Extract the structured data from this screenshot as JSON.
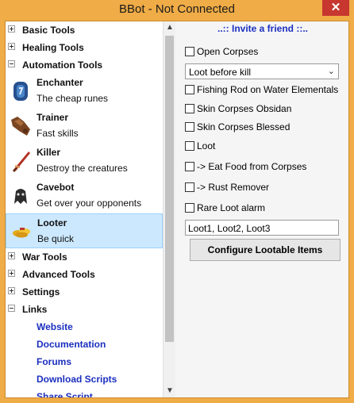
{
  "window": {
    "title": "BBot - Not Connected",
    "close_glyph": "✕"
  },
  "sidebar": {
    "categories": [
      {
        "label": "Basic Tools",
        "expanded": false
      },
      {
        "label": "Healing Tools",
        "expanded": false
      },
      {
        "label": "Automation Tools",
        "expanded": true
      },
      {
        "label": "War Tools",
        "expanded": false
      },
      {
        "label": "Advanced Tools",
        "expanded": false
      },
      {
        "label": "Settings",
        "expanded": false
      },
      {
        "label": "Links",
        "expanded": true
      }
    ],
    "tools": [
      {
        "name": "Enchanter",
        "desc": "The cheap runes",
        "icon": "enchanter-icon"
      },
      {
        "name": "Trainer",
        "desc": "Fast skills",
        "icon": "trainer-icon"
      },
      {
        "name": "Killer",
        "desc": "Destroy the creatures",
        "icon": "killer-icon"
      },
      {
        "name": "Cavebot",
        "desc": "Get over your opponents",
        "icon": "cavebot-icon"
      },
      {
        "name": "Looter",
        "desc": "Be quick",
        "icon": "looter-icon",
        "selected": true
      }
    ],
    "links": [
      "Website",
      "Documentation",
      "Forums",
      "Download Scripts",
      "Share Script"
    ]
  },
  "panel": {
    "invite": "..:: Invite a friend ::..",
    "open_corpses": "Open Corpses",
    "loot_mode": "Loot before kill",
    "fishing_rod": "Fishing Rod on Water Elementals",
    "skin_obsidian": "Skin Corpses Obsidan",
    "skin_blessed": "Skin Corpses Blessed",
    "loot": "Loot",
    "eat_food": "-> Eat Food from Corpses",
    "rust_remover": "-> Rust Remover",
    "rare_loot_alarm": "Rare Loot alarm",
    "loot_list": "Loot1, Loot2, Loot3",
    "configure_button": "Configure Lootable Items"
  },
  "colors": {
    "title_bar": "#f0ac46",
    "link": "#1b2fbf",
    "selection": "#cce8ff"
  }
}
